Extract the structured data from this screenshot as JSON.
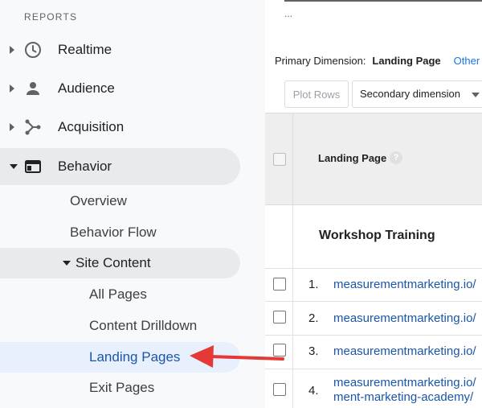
{
  "sidebar": {
    "section_label": "REPORTS",
    "items": [
      {
        "label": "Realtime",
        "icon": "clock-icon"
      },
      {
        "label": "Audience",
        "icon": "person-icon"
      },
      {
        "label": "Acquisition",
        "icon": "acquisition-icon"
      },
      {
        "label": "Behavior",
        "icon": "behavior-window-icon"
      }
    ],
    "behavior_children": {
      "overview": "Overview",
      "behavior_flow": "Behavior Flow",
      "site_content": "Site Content",
      "site_content_children": {
        "all_pages": "All Pages",
        "content_drilldown": "Content Drilldown",
        "landing_pages": "Landing Pages",
        "exit_pages": "Exit Pages"
      }
    }
  },
  "main": {
    "ellipsis": "...",
    "primary_dimension_label": "Primary Dimension:",
    "primary_dimension_value": "Landing Page",
    "primary_dimension_other": "Other",
    "plot_rows_label": "Plot Rows",
    "secondary_dimension_label": "Secondary dimension",
    "table": {
      "column_header": "Landing Page",
      "help_glyph": "?",
      "group_title": "Workshop Training",
      "rows": [
        {
          "num": "1.",
          "link": "measurementmarketing.io/"
        },
        {
          "num": "2.",
          "link": "measurementmarketing.io/"
        },
        {
          "num": "3.",
          "link": "measurementmarketing.io/"
        },
        {
          "num": "4.",
          "link": "measurementmarketing.io/",
          "link_line2": "ment-marketing-academy/"
        }
      ]
    }
  },
  "colors": {
    "accent_link": "#1a56a8",
    "selected_bg": "#e8f0fe",
    "annotation_arrow": "#e53935"
  }
}
